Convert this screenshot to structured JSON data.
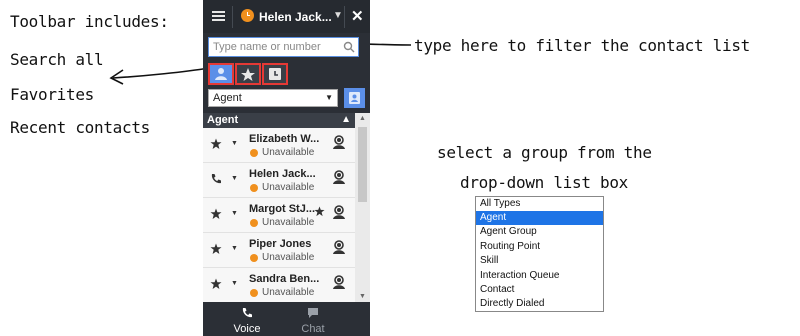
{
  "annotations": {
    "toolbar_heading": "Toolbar includes:",
    "item_search_all": "Search all",
    "item_favorites": "Favorites",
    "item_recent": "Recent contacts",
    "filter_hint": "type here to filter the contact list",
    "group_hint_line1": "select a group from the",
    "group_hint_line2": "drop-down list box"
  },
  "header": {
    "menu_icon": "hamburger-icon",
    "status_icon": "clock-icon",
    "agent_name": "Helen Jack...",
    "chevron": "⌄",
    "close_label": "✕"
  },
  "search": {
    "placeholder": "Type name or number",
    "icon": "search-icon"
  },
  "toolbar": {
    "buttons": [
      {
        "icon": "person-icon",
        "tooltip": "Search all",
        "active": true
      },
      {
        "icon": "star-icon",
        "tooltip": "Favorites",
        "active": false
      },
      {
        "icon": "recent-icon",
        "tooltip": "Recent contacts",
        "active": false
      }
    ]
  },
  "filter": {
    "selected": "Agent",
    "arrow": "▼"
  },
  "group": {
    "name": "Agent",
    "chevron": "⌃"
  },
  "contacts": [
    {
      "name": "Elizabeth W...",
      "status": "Unavailable",
      "action_icon": "star-action-icon",
      "favorite": false
    },
    {
      "name": "Helen Jack...",
      "status": "Unavailable",
      "action_icon": "phone-icon",
      "favorite": false
    },
    {
      "name": "Margot StJ...",
      "status": "Unavailable",
      "action_icon": "star-action-icon",
      "favorite": true
    },
    {
      "name": "Piper Jones",
      "status": "Unavailable",
      "action_icon": "star-action-icon",
      "favorite": false
    },
    {
      "name": "Sandra Ben...",
      "status": "Unavailable",
      "action_icon": "star-action-icon",
      "favorite": false
    }
  ],
  "bottom_tabs": [
    {
      "label": "Voice",
      "icon": "phone-icon",
      "active": true
    },
    {
      "label": "Chat",
      "icon": "chat-icon",
      "active": false
    }
  ],
  "group_dropdown": {
    "options": [
      "All Types",
      "Agent",
      "Agent Group",
      "Routing Point",
      "Skill",
      "Interaction Queue",
      "Contact",
      "Directly Dialed"
    ],
    "selected": "Agent"
  },
  "colors": {
    "panel_bg": "#2b2f36",
    "accent_blue": "#5b8fe8",
    "highlight_red": "#e53935",
    "status_orange": "#f0901e",
    "selection_blue": "#1e74e6"
  }
}
